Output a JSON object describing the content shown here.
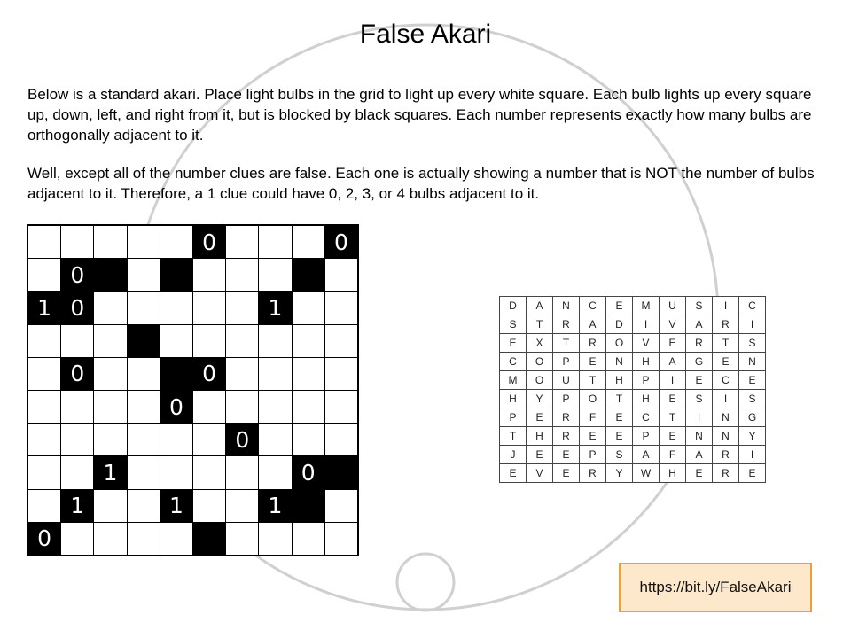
{
  "title": "False Akari",
  "paragraph1": "Below is a standard akari. Place light bulbs in the grid to light up every white square. Each bulb lights up every square up, down, left, and right from it, but is blocked by black squares. Each number represents exactly how many bulbs are orthogonally adjacent to it.",
  "paragraph2": "Well, except all of the number clues are false. Each one is actually showing a number that is NOT the number of bulbs adjacent to it. Therefore, a 1 clue could have 0, 2, 3, or 4 bulbs adjacent to it.",
  "akari_grid": [
    [
      ".",
      ".",
      ".",
      ".",
      ".",
      "0",
      ".",
      ".",
      ".",
      "0"
    ],
    [
      ".",
      "0",
      "#",
      ".",
      "#",
      ".",
      ".",
      ".",
      "#",
      "."
    ],
    [
      "1",
      "0",
      ".",
      ".",
      ".",
      ".",
      ".",
      "1",
      ".",
      "."
    ],
    [
      ".",
      ".",
      ".",
      "#",
      ".",
      ".",
      ".",
      ".",
      ".",
      "."
    ],
    [
      ".",
      "0",
      ".",
      ".",
      "#",
      "0",
      ".",
      ".",
      ".",
      "."
    ],
    [
      ".",
      ".",
      ".",
      ".",
      "0",
      ".",
      ".",
      ".",
      ".",
      "."
    ],
    [
      ".",
      ".",
      ".",
      ".",
      ".",
      ".",
      "0",
      ".",
      ".",
      "."
    ],
    [
      ".",
      ".",
      "1",
      ".",
      ".",
      ".",
      ".",
      ".",
      "0",
      "#"
    ],
    [
      ".",
      "1",
      ".",
      ".",
      "1",
      ".",
      ".",
      "1",
      "#",
      "."
    ],
    [
      "0",
      ".",
      ".",
      ".",
      ".",
      "#",
      ".",
      ".",
      ".",
      "."
    ]
  ],
  "word_search": [
    [
      "D",
      "A",
      "N",
      "C",
      "E",
      "M",
      "U",
      "S",
      "I",
      "C"
    ],
    [
      "S",
      "T",
      "R",
      "A",
      "D",
      "I",
      "V",
      "A",
      "R",
      "I"
    ],
    [
      "E",
      "X",
      "T",
      "R",
      "O",
      "V",
      "E",
      "R",
      "T",
      "S"
    ],
    [
      "C",
      "O",
      "P",
      "E",
      "N",
      "H",
      "A",
      "G",
      "E",
      "N"
    ],
    [
      "M",
      "O",
      "U",
      "T",
      "H",
      "P",
      "I",
      "E",
      "C",
      "E"
    ],
    [
      "H",
      "Y",
      "P",
      "O",
      "T",
      "H",
      "E",
      "S",
      "I",
      "S"
    ],
    [
      "P",
      "E",
      "R",
      "F",
      "E",
      "C",
      "T",
      "I",
      "N",
      "G"
    ],
    [
      "T",
      "H",
      "R",
      "E",
      "E",
      "P",
      "E",
      "N",
      "N",
      "Y"
    ],
    [
      "J",
      "E",
      "E",
      "P",
      "S",
      "A",
      "F",
      "A",
      "R",
      "I"
    ],
    [
      "E",
      "V",
      "E",
      "R",
      "Y",
      "W",
      "H",
      "E",
      "R",
      "E"
    ]
  ],
  "link_text": "https://bit.ly/FalseAkari",
  "colors": {
    "decor_circle": "#d0d0d0",
    "link_border": "#f0a030",
    "link_fill": "#fde8cc"
  }
}
